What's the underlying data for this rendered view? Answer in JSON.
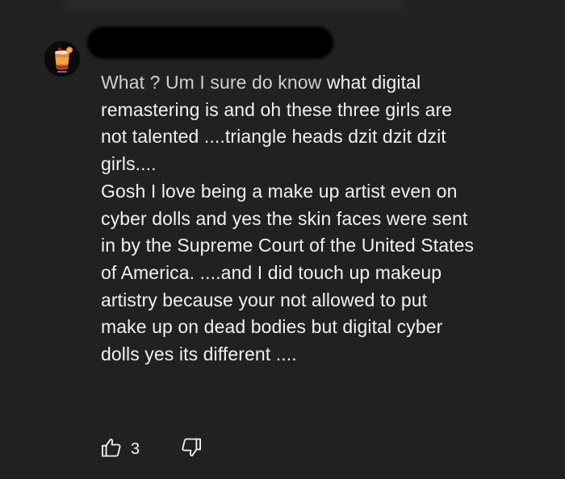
{
  "comment": {
    "author_hidden": true,
    "lead": "What ? Um I sure do know ",
    "lines_part1": "what digital\nremastering is and oh these three girls are\nnot talented ....triangle heads dzit dzit dzit\ngirls....",
    "lines_part2": "Gosh I love being a make up artist even on\ncyber dolls and yes the skin faces were sent\nin by the Supreme Court of the United States\nof America. ....and I did touch up makeup\nartistry because your not allowed to put\nmake up on dead bodies but digital cyber\ndolls yes its different ...."
  },
  "actions": {
    "like_count": "3",
    "like_icon": "thumb-up-icon",
    "dislike_icon": "thumb-down-icon"
  },
  "colors": {
    "background": "#212121",
    "text": "#f1f1f1"
  }
}
